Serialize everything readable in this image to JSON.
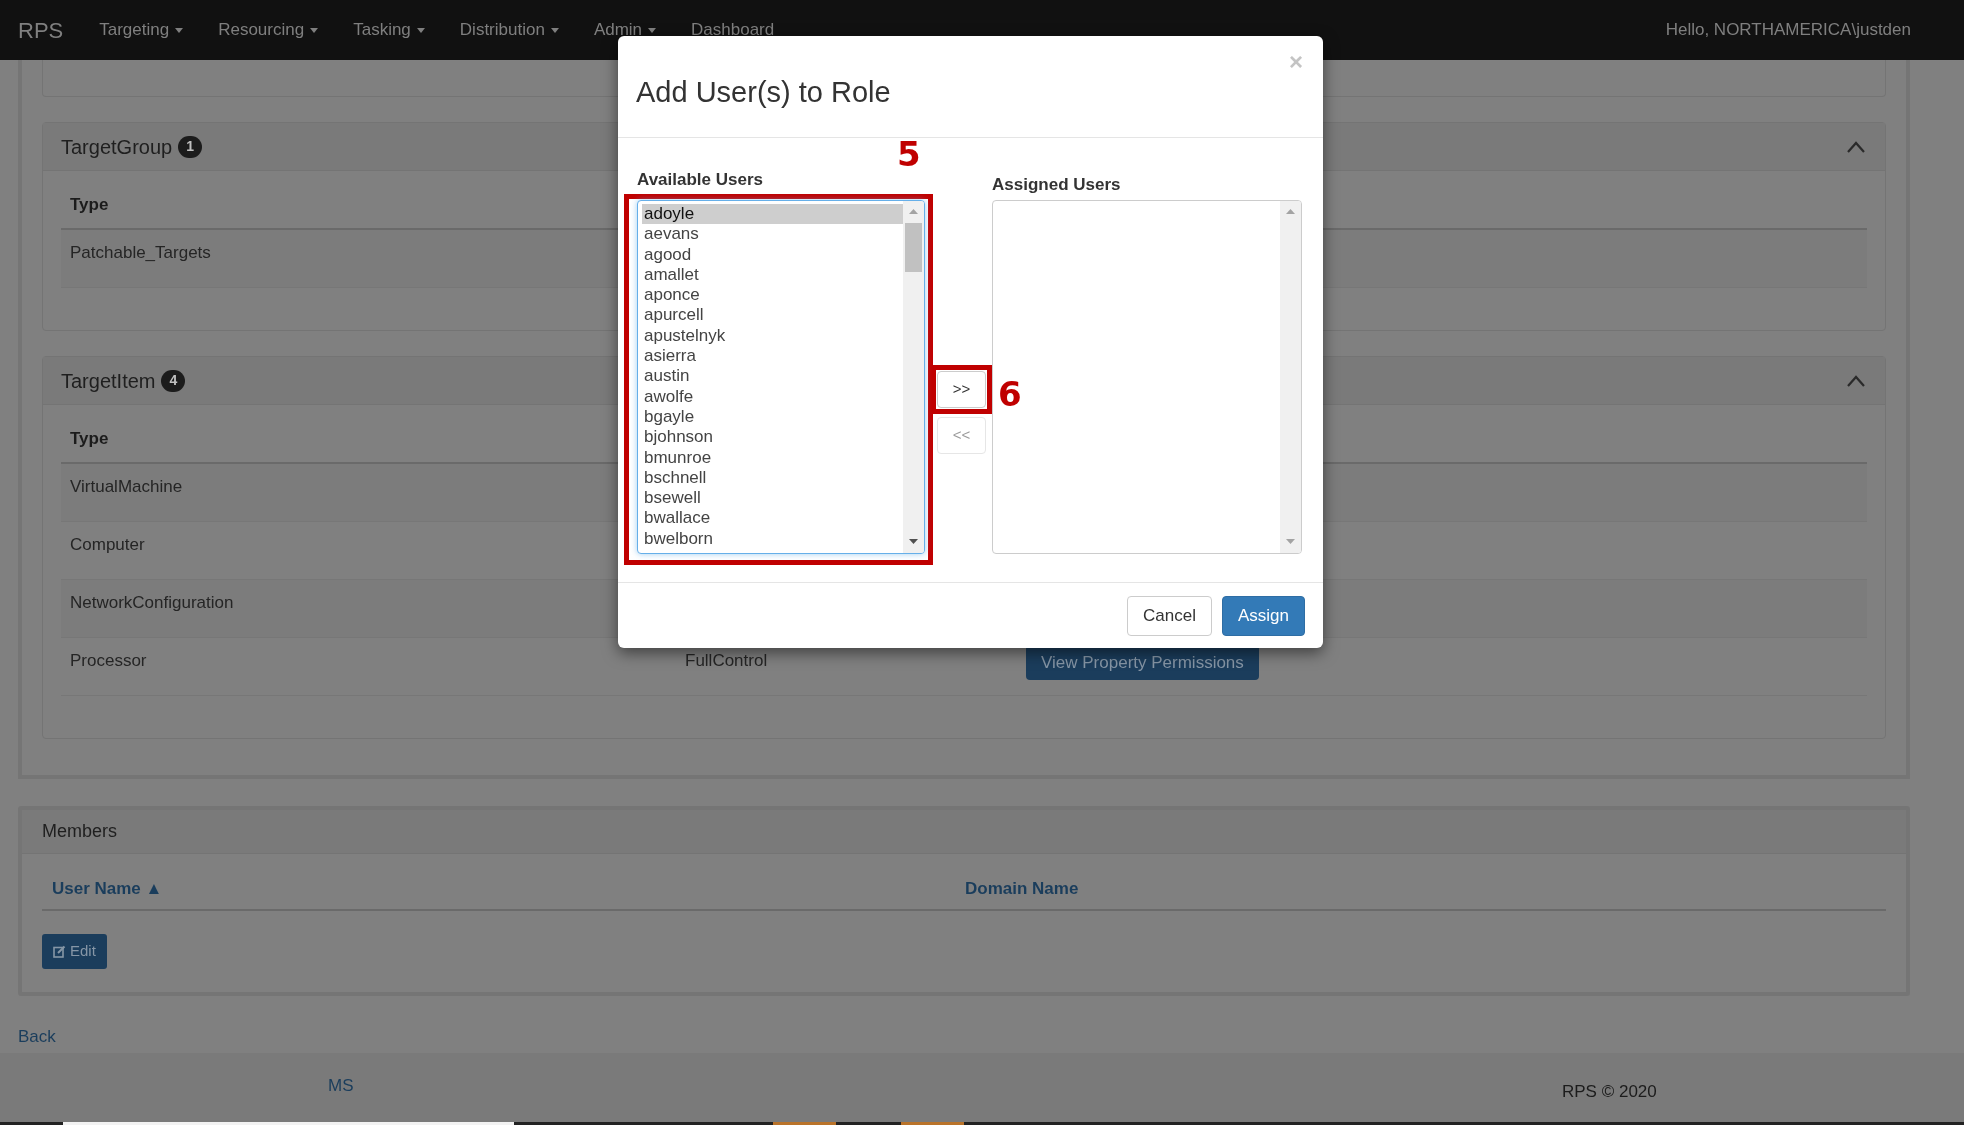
{
  "navbar": {
    "brand": "RPS",
    "menus": [
      {
        "label": "Targeting",
        "dropdown": true
      },
      {
        "label": "Resourcing",
        "dropdown": true
      },
      {
        "label": "Tasking",
        "dropdown": true
      },
      {
        "label": "Distribution",
        "dropdown": true
      },
      {
        "label": "Admin",
        "dropdown": true
      },
      {
        "label": "Dashboard",
        "dropdown": false
      }
    ],
    "user": "Hello, NORTHAMERICA\\justden"
  },
  "panels": [
    {
      "title": "TargetGroup",
      "count": "1",
      "expanded": true,
      "columns": [
        "Type"
      ],
      "rows": [
        {
          "cells": [
            "Patchable_Targets"
          ]
        }
      ]
    },
    {
      "title": "TargetItem",
      "count": "4",
      "expanded": true,
      "columns": [
        "Type"
      ],
      "rows": [
        {
          "cells": [
            "VirtualMachine"
          ]
        },
        {
          "cells": [
            "Computer"
          ]
        },
        {
          "cells": [
            "NetworkConfiguration"
          ]
        },
        {
          "cells": [
            "Processor",
            "FullControl"
          ],
          "action": "View Property Permissions"
        }
      ]
    }
  ],
  "members": {
    "title": "Members",
    "columns": [
      {
        "label": "User Name",
        "sort": "▲"
      },
      {
        "label": "Domain Name"
      }
    ],
    "edit_button": "Edit"
  },
  "back_link": "Back",
  "footer": {
    "left": "MS",
    "right": "RPS © 2020"
  },
  "modal": {
    "title": "Add User(s) to Role",
    "close": "×",
    "available": {
      "label": "Available Users",
      "items": [
        {
          "name": "adoyle",
          "selected": true
        },
        {
          "name": "aevans",
          "selected": false
        },
        {
          "name": "agood",
          "selected": false
        },
        {
          "name": "amallet",
          "selected": false
        },
        {
          "name": "aponce",
          "selected": false
        },
        {
          "name": "apurcell",
          "selected": false
        },
        {
          "name": "apustelnyk",
          "selected": false
        },
        {
          "name": "asierra",
          "selected": false
        },
        {
          "name": "austin",
          "selected": false
        },
        {
          "name": "awolfe",
          "selected": false
        },
        {
          "name": "bgayle",
          "selected": false
        },
        {
          "name": "bjohnson",
          "selected": false
        },
        {
          "name": "bmunroe",
          "selected": false
        },
        {
          "name": "bschnell",
          "selected": false
        },
        {
          "name": "bsewell",
          "selected": false
        },
        {
          "name": "bwallace",
          "selected": false
        },
        {
          "name": "bwelborn",
          "selected": false
        }
      ]
    },
    "assigned": {
      "label": "Assigned Users"
    },
    "move_buttons": [
      {
        "label": ">>",
        "highlighted": true
      },
      {
        "label": "<<",
        "highlighted": false
      }
    ],
    "annotations": [
      {
        "label": "5"
      },
      {
        "label": "6"
      }
    ],
    "buttons": [
      {
        "label": "Cancel",
        "kind": "default"
      },
      {
        "label": "Assign",
        "kind": "primary"
      }
    ]
  }
}
